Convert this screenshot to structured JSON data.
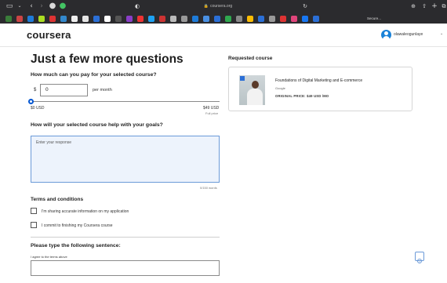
{
  "browser": {
    "address": "coursera.org",
    "favorites_label": "Secure...",
    "toolbar_icons": [
      "sidebar-icon",
      "back-icon",
      "forward-icon",
      "shield-icon",
      "reload-icon",
      "share-icon",
      "new-tab-icon",
      "tabs-icon"
    ],
    "favorite_colors": [
      "#3a7d3a",
      "#c44",
      "#1e7bd8",
      "#ad2",
      "#d33",
      "#38c",
      "#eee",
      "#e5e5e5",
      "#2b6fd6",
      "#fff",
      "#555",
      "#8a3ec8",
      "#e33",
      "#1da1f2",
      "#c33",
      "#bbb",
      "#999",
      "#1e7bd8",
      "#4a90e2",
      "#2b6fd6",
      "#2fa84f",
      "#888",
      "#fbbc04",
      "#2b6fd6",
      "#999",
      "#d33",
      "#e0457b",
      "#1877f2",
      "#2b6fd6"
    ]
  },
  "header": {
    "logo": "coursera",
    "username": "olawaleogunlaye"
  },
  "form": {
    "title": "Just a few more questions",
    "pay_question": "How much can you pay for your selected course?",
    "currency_symbol": "$",
    "amount_value": "0",
    "per_month": "per month",
    "range_min": "$0 USD",
    "range_max": "$49 USD",
    "full_price": "Full price",
    "slider_value": 0,
    "goals_question": "How will your selected course help with your goals?",
    "goals_placeholder": "Enter your response",
    "word_count": "0/150 words",
    "terms_title": "Terms and conditions",
    "terms": [
      {
        "label": "I'm sharing accurate information on my application",
        "checked": false
      },
      {
        "label": "I commit to finishing my Coursera course",
        "checked": false
      }
    ],
    "type_title": "Please type the following sentence:",
    "sentence": "I agree to the terms above"
  },
  "course": {
    "section_title": "Requested course",
    "name": "Foundations of Digital Marketing and E-commerce",
    "provider": "Google",
    "price": "ORIGINAL PRICE: $49 USD /MO"
  },
  "help": {
    "icon": "help-icon"
  }
}
